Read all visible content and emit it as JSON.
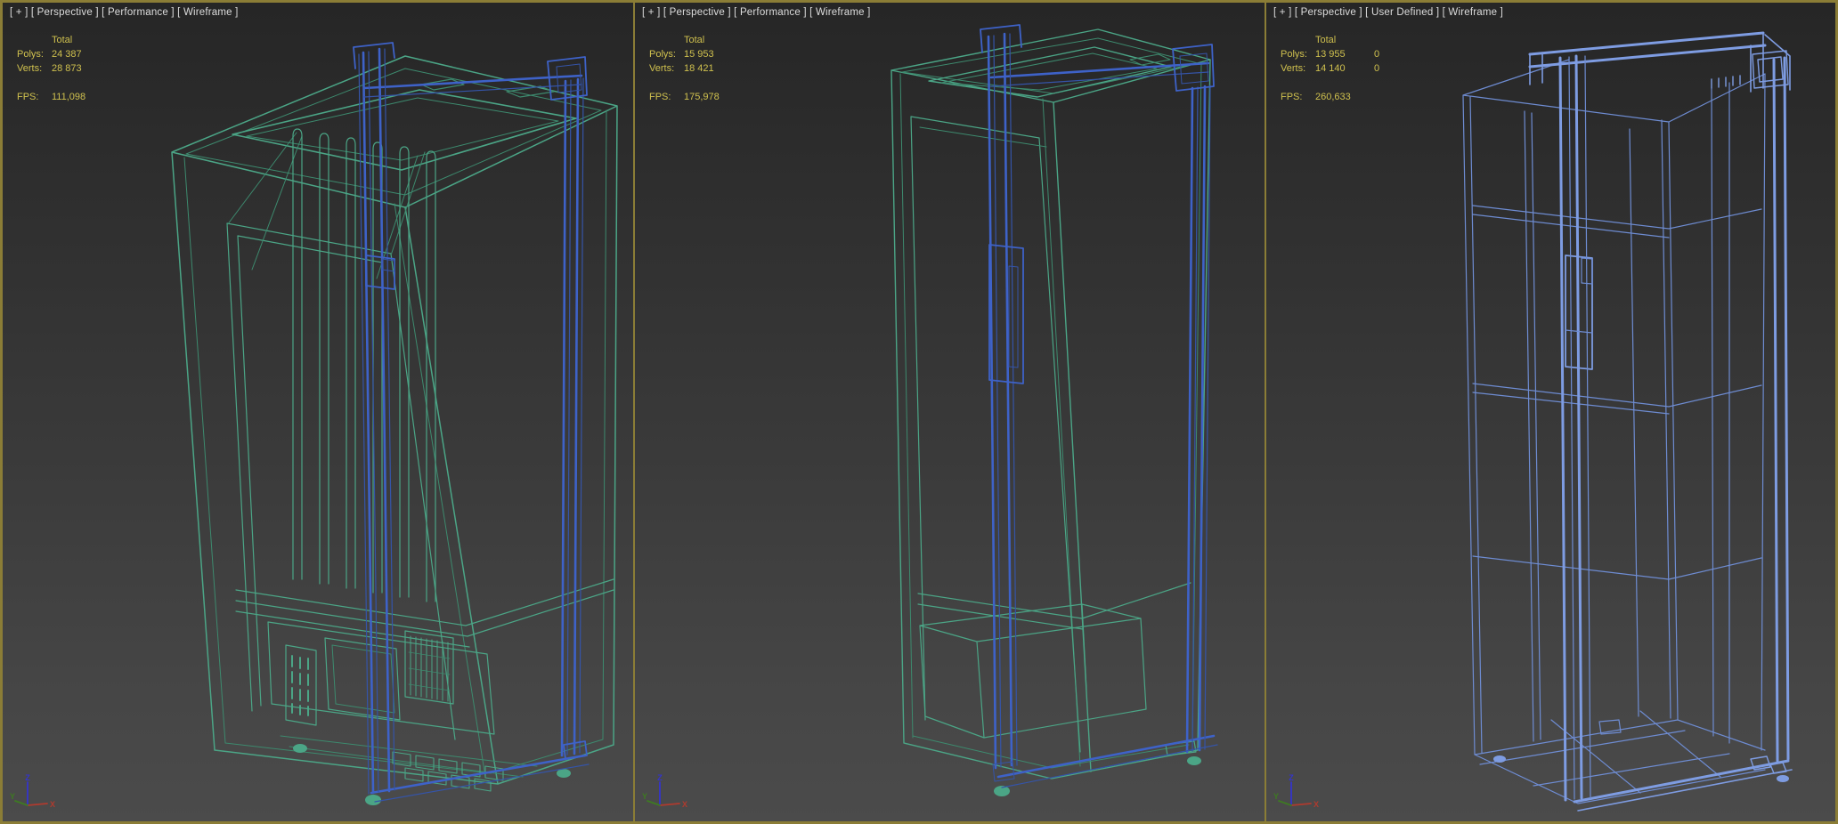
{
  "colors": {
    "background_top": "#262626",
    "background_mid": "#3a3a3a",
    "background_bottom": "#4b4b4b",
    "viewport_border": "#8b7d36",
    "header_text": "#dcdcdc",
    "stats_text": "#cfc04e",
    "wire_green": "#4BA586",
    "wire_green_dim": "#3D8A6E",
    "wire_blue": "#3E62C8",
    "wire_blue_dim": "#3554A8",
    "wire_blue_light": "#7E9CE2",
    "wire_blue_light_dim": "#6E8CD2",
    "axis_x": "#B03A2E",
    "axis_y": "#3E7A22",
    "axis_z": "#3434CC"
  },
  "gizmo": {
    "x_label": "X",
    "y_label": "Y",
    "z_label": "Z"
  },
  "viewports": [
    {
      "header": "[ + ] [ Perspective ] [ Performance ] [ Wireframe ]",
      "stats": {
        "total_label": "Total",
        "polys_label": "Polys:",
        "polys": "24 387",
        "verts_label": "Verts:",
        "verts": "28 873",
        "fps_label": "FPS:",
        "fps": "111,098"
      }
    },
    {
      "header": "[ + ] [ Perspective ] [ Performance ] [ Wireframe ]",
      "stats": {
        "total_label": "Total",
        "polys_label": "Polys:",
        "polys": "15 953",
        "verts_label": "Verts:",
        "verts": "18 421",
        "fps_label": "FPS:",
        "fps": "175,978"
      }
    },
    {
      "header": "[ + ] [ Perspective ] [ User Defined ] [ Wireframe ]",
      "stats": {
        "total_label": "Total",
        "polys_label": "Polys:",
        "polys": "13 955",
        "polys_sel": "0",
        "verts_label": "Verts:",
        "verts": "14 140",
        "verts_sel": "0",
        "fps_label": "FPS:",
        "fps": "260,633"
      }
    }
  ]
}
